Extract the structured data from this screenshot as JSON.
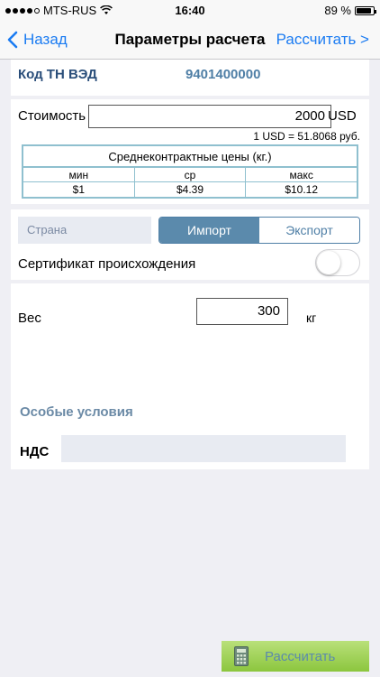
{
  "status_bar": {
    "carrier": "MTS-RUS",
    "time": "16:40",
    "battery_text": "89 %",
    "battery_level": 0.89
  },
  "nav": {
    "back_label": "Назад",
    "title": "Параметры расчета",
    "action_label": "Рассчитать >"
  },
  "code": {
    "label": "Код ТН ВЭД",
    "value": "9401400000"
  },
  "cost": {
    "label": "Стоимость",
    "value": "2000",
    "currency": "USD",
    "rate": "1 USD = 51.8068 руб."
  },
  "prices": {
    "title": "Среднеконтрактные цены (кг.)",
    "headers": [
      "мин",
      "ср",
      "макс"
    ],
    "values": [
      "$1",
      "$4.39",
      "$10.12"
    ]
  },
  "country": {
    "placeholder": "Страна",
    "segments": [
      "Импорт",
      "Экспорт"
    ],
    "selected_segment": "Импорт"
  },
  "certificate": {
    "label": "Сертификат происхождения",
    "enabled": false
  },
  "weight": {
    "label": "Вес",
    "value": "300",
    "unit": "кг"
  },
  "special_conditions": {
    "title": "Особые условия"
  },
  "vat": {
    "label": "НДС",
    "value": ""
  },
  "bottom_button": {
    "label": "Рассчитать",
    "icon": "calculator-icon"
  },
  "colors": {
    "accent_blue": "#1a7bf2",
    "segment_active": "#5b8aac",
    "button_green": "#8cc63e",
    "code_label": "#2a4e7a"
  }
}
